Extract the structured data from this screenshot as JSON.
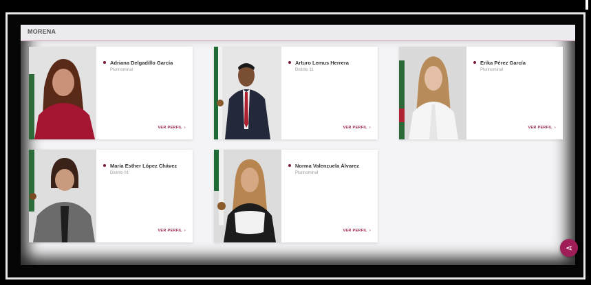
{
  "section": {
    "title": "MORENA"
  },
  "cards": [
    {
      "name": "Adriana Delgadillo García",
      "role": "Plurinominal",
      "link": "VER PERFIL",
      "arrow": "›"
    },
    {
      "name": "Arturo Lemus Herrera",
      "role": "Distrito 11",
      "link": "VER PERFIL",
      "arrow": "›"
    },
    {
      "name": "Erika Pérez García",
      "role": "Plurinominal",
      "link": "VER PERFIL",
      "arrow": "›"
    },
    {
      "name": "María Esther López Chávez",
      "role": "Distrito 01",
      "link": "VER PERFIL",
      "arrow": "›"
    },
    {
      "name": "Norma Valenzuela Álvarez",
      "role": "Plurinominal",
      "link": "VER PERFIL",
      "arrow": "›"
    }
  ],
  "fab": {
    "icon": "share-icon",
    "glyph": "⋖"
  },
  "colors": {
    "accent": "#9b2247",
    "bullet": "#7a1b3a",
    "fab": "#a01e58"
  }
}
